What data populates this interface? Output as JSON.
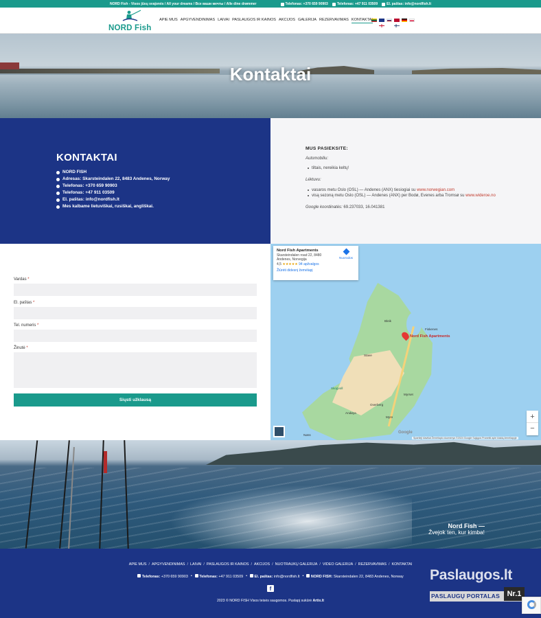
{
  "topbar": {
    "tagline": "NORD Fish - Visos jūsų svajonės / All your dreams / Все ваши мечты / Alle dine drømmer",
    "phone1": "Telefonas: +370 659 90903",
    "phone2": "Telefonas: +47 911 03509",
    "email": "El. paštas: info@nordfish.lt"
  },
  "header": {
    "logo_text": "NORD Fish",
    "nav": [
      "APIE MUS",
      "APGYVENDINIMAS",
      "LAIVAI",
      "PASLAUGOS IR KAINOS",
      "AKCIJOS",
      "GALERIJA",
      "REZERVAVIMAS",
      "KONTAKTAI"
    ],
    "active": "KONTAKTAI",
    "flags": [
      "lithuania-flag-icon",
      "uk-flag-icon",
      "russia-flag-icon",
      "norway-flag-icon",
      "germany-flag-icon",
      "poland-flag-icon"
    ]
  },
  "hero": {
    "title": "Kontaktai"
  },
  "contacts": {
    "heading": "KONTAKTAI",
    "items": [
      "NORD FISH",
      "Adresas: Skarsteindalen 22, 8483 Andenes, Norway",
      "Telefonas: +370 659 90903",
      "Telefonas: +47 911 03509",
      "El. paštas: info@nordfish.lt",
      "Mes kalbame lietuviškai, rusiškai, angliškai."
    ]
  },
  "findus": {
    "heading": "MUS PASIEKSITE:",
    "car_label": "Automobiliu:",
    "car_item": "tiltais, nereikia keltų!",
    "plane_label": "Lėktuvu:",
    "plane_item1_text": "vasaros metu Oslo (OSL) — Andenes (ANX) tiesiogiai su ",
    "plane_item1_link": "www.norwegian.com",
    "plane_item2_text": "visą sezoną metu Oslo (OSL) — Andenes (ANX) per Bodø, Evenes arba Tromsø su ",
    "plane_item2_link": "www.wideroe.no",
    "coords_label": "Google koordinatės:",
    "coords_value": " 69.237033, 16.041381"
  },
  "form": {
    "name_label": "Vardas",
    "email_label": "El. paštas",
    "phone_label": "Tel. numeris",
    "message_label": "Žinutė",
    "required_mark": "*",
    "submit_label": "Siųsti užklausą"
  },
  "map": {
    "place_name": "Nord Fish Apartments",
    "address": "Skarsteindalen road 22, 8480 Andenes, Norvegija",
    "rating": "4,5",
    "stars": "★★★★★",
    "reviews": "94 apžvalgos",
    "larger_map": "Žiūrėti didesnį žemėlapį",
    "directions": "Nuorodos",
    "pin_label": "Nord Fish Apartments",
    "towns": [
      "Bleik",
      "Fiskenes",
      "Stave",
      "Skogvoll",
      "Myrset",
      "Overberg",
      "Andøya",
      "Myre",
      "Nøss"
    ],
    "zoom_in": "+",
    "zoom_out": "−",
    "google": "Google",
    "attribution": "Spartieji klavišai   Žemėlapio duomenys ©2024 Google   Sąlygos   Pranešti apie klaidą žemėlapyje"
  },
  "banner": {
    "line1": "Nord Fish —",
    "line2": "Žvejok ten, kur kimba!"
  },
  "footer": {
    "links": [
      "APIE MUS",
      "APGYVENDINIMAS",
      "LAIVAI",
      "PASLAUGOS IR KAINOS",
      "AKCIJOS",
      "NUOTRAUKŲ GALERIJA",
      "VIDEO GALERIJA",
      "REZERVAVIMAS",
      "KONTAKTAI"
    ],
    "phone1_label": "Telefonas:",
    "phone1": "+370 659 90903",
    "phone2_label": "Telefonas:",
    "phone2": "+47 911 03509",
    "email_label": "El. paštas:",
    "email": "info@nordfish.lt",
    "address_label": "NORD FISH:",
    "address": "Skarsteindalen 22, 8483 Andenes, Norway",
    "copyright": "2023 © NORD FISH Visos teisės saugomos. Puslapį sukūrė ",
    "credit": "Artix.lt"
  },
  "badge": {
    "title": "Paslaugos.lt",
    "subtitle": "PASLAUGŲ PORTALAS",
    "nr": "Nr.1"
  }
}
